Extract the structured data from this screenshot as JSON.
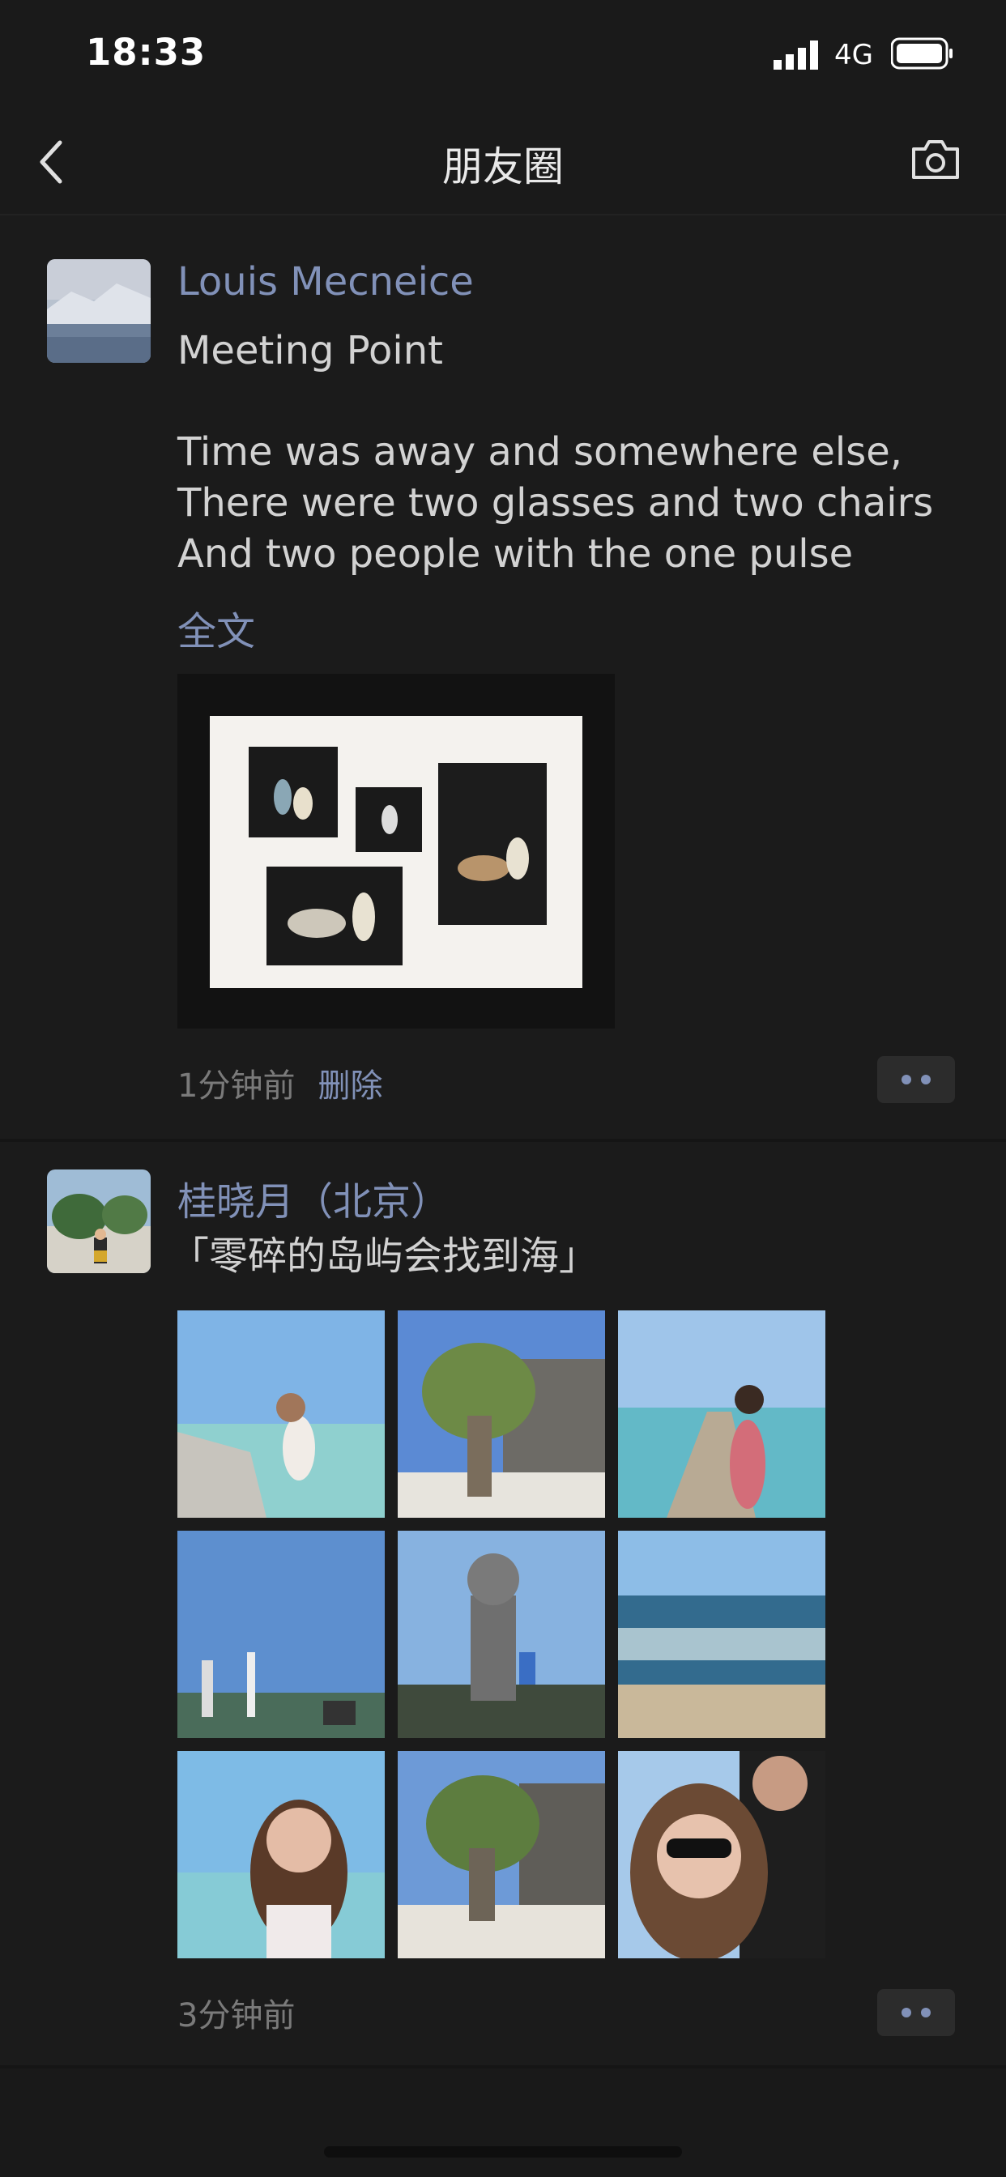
{
  "status": {
    "time": "18:33",
    "network": "4G"
  },
  "nav": {
    "title": "朋友圈"
  },
  "posts": [
    {
      "author": "Louis Mecneice",
      "lines": [
        "Meeting Point",
        "",
        "Time was away and somewhere else,",
        "There were two glasses and two chairs",
        "And two people with the one pulse"
      ],
      "expand_label": "全文",
      "time": "1分钟前",
      "delete_label": "删除"
    },
    {
      "author": "桂晓月（北京）",
      "lines": [
        "「零碎的岛屿会找到海」"
      ],
      "time": "3分钟前"
    }
  ],
  "colors": {
    "link": "#8191b8",
    "background": "#191919",
    "text": "#d2d2d2"
  }
}
